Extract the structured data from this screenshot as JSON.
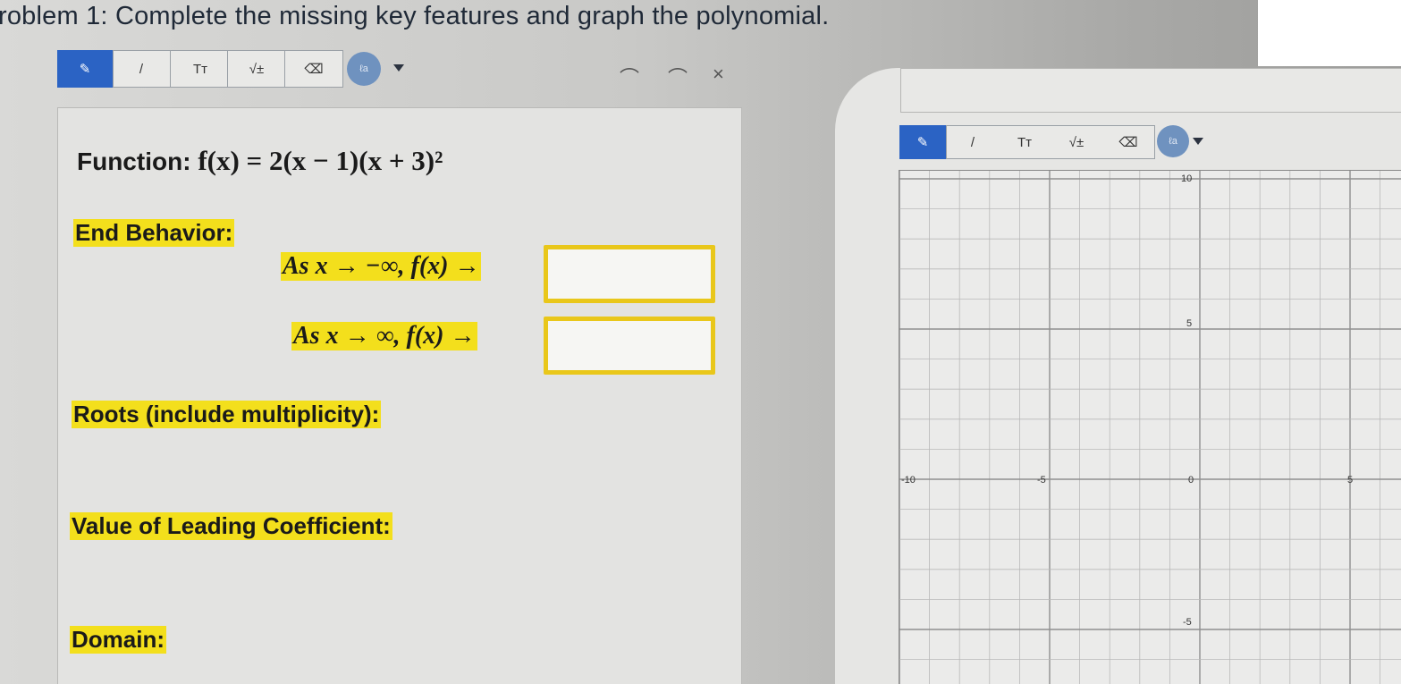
{
  "header": {
    "problem_title": "roblem 1: Complete the missing key features and graph the polynomial."
  },
  "toolbar": {
    "tools": [
      {
        "name": "pen",
        "glyph": "✎"
      },
      {
        "name": "line",
        "glyph": "/"
      },
      {
        "name": "text",
        "glyph": "Tт"
      },
      {
        "name": "math",
        "glyph": "√±"
      },
      {
        "name": "eraser",
        "glyph": "⌫"
      },
      {
        "name": "color",
        "glyph": "ℓa"
      }
    ],
    "undo_glyph": "⌒",
    "redo_glyph": "⌒",
    "close_glyph": "×"
  },
  "worksheet": {
    "function_label": "Function:",
    "function_expr": "f(x) = 2(x − 1)(x + 3)²",
    "end_behavior_label": "End Behavior:",
    "end_behavior_neg": "As x → −∞, f(x) →",
    "end_behavior_pos": "As x → ∞, f(x) →",
    "end_behavior_neg_answer": "",
    "end_behavior_pos_answer": "",
    "roots_label": "Roots (include multiplicity):",
    "leading_coefficient_label": "Value of Leading Coefficient:",
    "domain_label": "Domain:"
  },
  "graph": {
    "x_labels": [
      "-10",
      "-5",
      "0",
      "5"
    ],
    "y_labels": [
      "10",
      "5",
      "-5"
    ],
    "accent": "#2b63c4",
    "highlight": "#f3df1c",
    "box_border": "#e9c71a"
  }
}
